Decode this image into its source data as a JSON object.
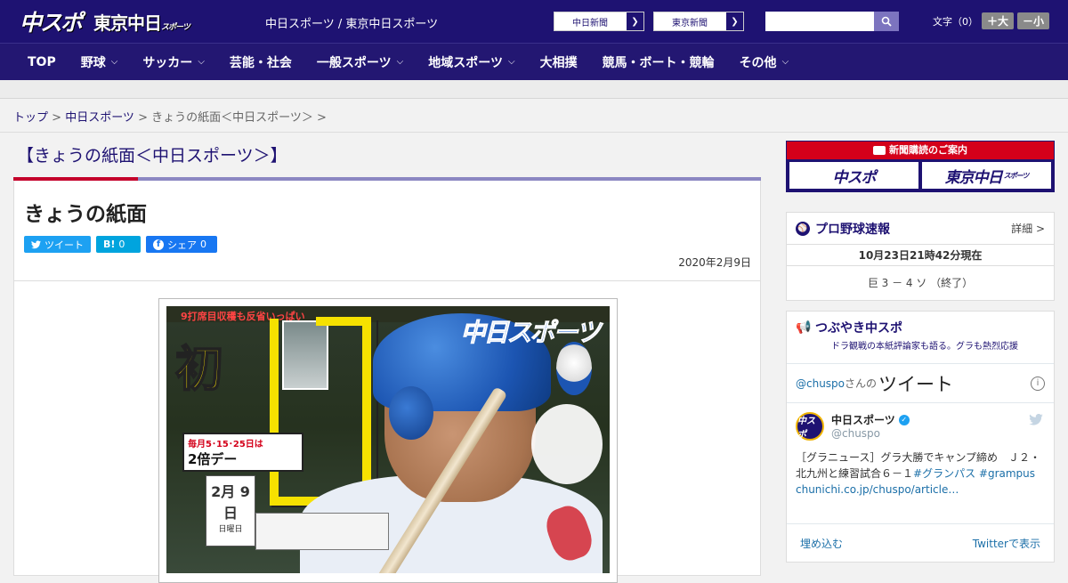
{
  "header": {
    "logo_chuspo": "中スポ",
    "logo_tokyo": "東京中日",
    "logo_tokyo_small": "スポーツ",
    "site_title": "中日スポーツ / 東京中日スポーツ",
    "ext_links": [
      "中日新聞",
      "東京新聞"
    ],
    "search_placeholder": "",
    "fontsize_label": "文字（0）",
    "fontsize_plus": "＋大",
    "fontsize_minus": "－小"
  },
  "nav": {
    "items": [
      {
        "label": "TOP"
      },
      {
        "label": "野球",
        "dropdown": true
      },
      {
        "label": "サッカー",
        "dropdown": true
      },
      {
        "label": "芸能・社会"
      },
      {
        "label": "一般スポーツ",
        "dropdown": true
      },
      {
        "label": "地域スポーツ",
        "dropdown": true
      },
      {
        "label": "大相撲"
      },
      {
        "label": "競馬・ボート・競輪"
      },
      {
        "label": "その他",
        "dropdown": true
      }
    ]
  },
  "breadcrumb": {
    "top": "トップ",
    "sep1": " > ",
    "section": "中日スポーツ",
    "sep2": " > ",
    "current": "きょうの紙面＜中日スポーツ＞ >"
  },
  "main": {
    "heading": "【きょうの紙面＜中日スポーツ＞】",
    "article_title": "きょうの紙面",
    "share": {
      "tweet": "ツイート",
      "hatena": "B!",
      "hatena_count": "0",
      "facebook": "シェア",
      "facebook_count": "0"
    },
    "date": "2020年2月9日",
    "paper": {
      "top_caption": "9打席目収穫も反省いっぱい",
      "masthead": "中日スポーツ",
      "promo_line1": "毎月5･15･25日は",
      "promo_line2": "2倍デー",
      "date_month": "2月",
      "date_day": "9日",
      "date_weekday": "日曜日"
    }
  },
  "sidebar": {
    "subscribe_title": "新聞購読のご案内",
    "subscribe_btn1": "中スポ",
    "subscribe_btn2": "東京中日",
    "subscribe_btn2_small": "スポーツ",
    "baseball": {
      "title": "プロ野球速報",
      "detail": "詳細 >",
      "time": "10月23日21時42分現在",
      "score": "巨 3 － 4 ソ （終了）"
    },
    "tweets": {
      "title": "つぶやき中スポ",
      "subtitle": "ドラ観戦の本紙評論家も語る。グラも熱烈応援",
      "account": "@chuspo",
      "account_suffix": "さんの",
      "heading": "ツイート",
      "user_name": "中日スポーツ",
      "user_handle": "@chuspo",
      "avatar": "中スポ",
      "text_plain": "［グラニュース］グラ大勝でキャンプ締め　Ｊ２・北九州と練習試合６－１",
      "tag1": "#グランパス",
      "tag2": "#grampus",
      "link": "chunichi.co.jp/chuspo/article…",
      "embed": "埋め込む",
      "view_on_twitter": "Twitterで表示"
    }
  },
  "colors": {
    "brand_navy": "#1e1272",
    "accent_red": "#d4001a",
    "twitter_blue": "#1da1f2"
  }
}
